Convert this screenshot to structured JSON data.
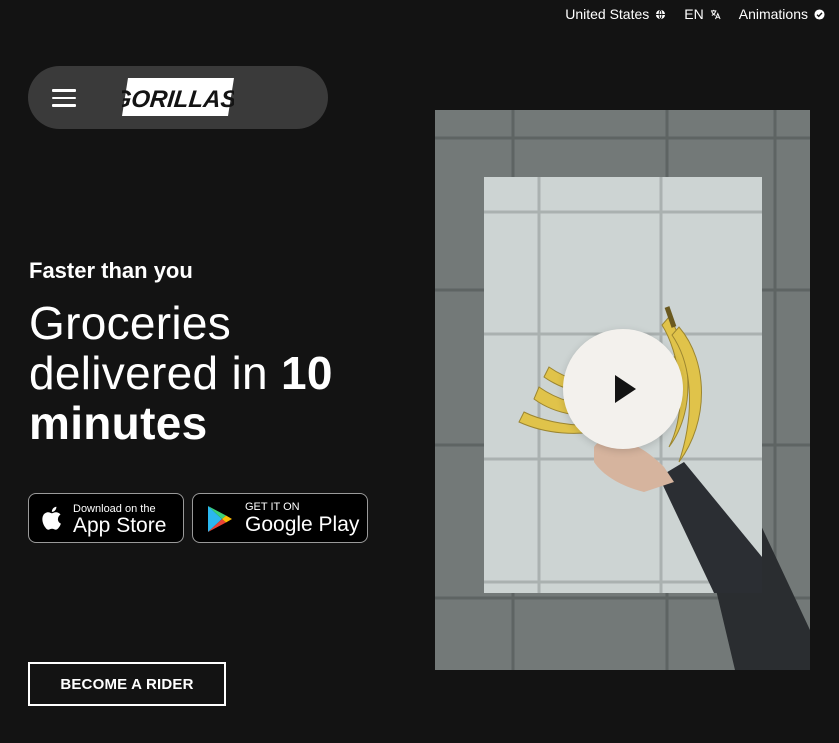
{
  "topbar": {
    "country": "United States",
    "language": "EN",
    "animations": "Animations"
  },
  "nav": {
    "logo_text": "GORILLAS"
  },
  "hero": {
    "tagline": "Faster than you",
    "headline_line1": "Groceries",
    "headline_line2_normal": "delivered in ",
    "headline_line2_bold": "10",
    "headline_line3_bold": "minutes"
  },
  "badges": {
    "appstore_small": "Download on the",
    "appstore_big": "App Store",
    "play_small": "GET IT ON",
    "play_big": "Google Play"
  },
  "rider_button": "BECOME A RIDER",
  "colors": {
    "background": "#131313",
    "nav_pill": "#3a3a3a",
    "play_button": "#f3f1ed"
  },
  "icons": [
    "globe-icon",
    "translate-icon",
    "check-circle-icon",
    "hamburger-icon",
    "apple-icon",
    "google-play-icon",
    "play-icon"
  ]
}
